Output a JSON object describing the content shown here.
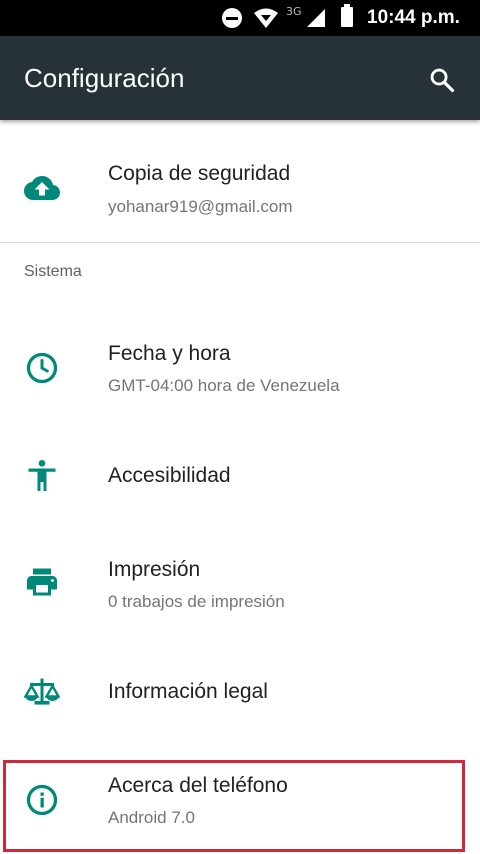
{
  "status_bar": {
    "network": "3G",
    "time": "10:44 p.m."
  },
  "toolbar": {
    "title": "Configuración",
    "search_icon": "search-icon"
  },
  "accent_color": "#00897b",
  "items_top": [
    {
      "id": "backup",
      "icon": "cloud-upload-icon",
      "title": "Copia de seguridad",
      "summary": "yohanar919@gmail.com"
    }
  ],
  "section": {
    "header": "Sistema",
    "items": [
      {
        "id": "date-time",
        "icon": "clock-icon",
        "title": "Fecha y hora",
        "summary": "GMT-04:00 hora de Venezuela"
      },
      {
        "id": "accessibility",
        "icon": "accessibility-icon",
        "title": "Accesibilidad",
        "summary": ""
      },
      {
        "id": "printing",
        "icon": "printer-icon",
        "title": "Impresión",
        "summary": "0 trabajos de impresión"
      },
      {
        "id": "legal",
        "icon": "scale-icon",
        "title": "Información legal",
        "summary": ""
      },
      {
        "id": "about",
        "icon": "info-icon",
        "title": "Acerca del teléfono",
        "summary": "Android 7.0"
      }
    ]
  }
}
